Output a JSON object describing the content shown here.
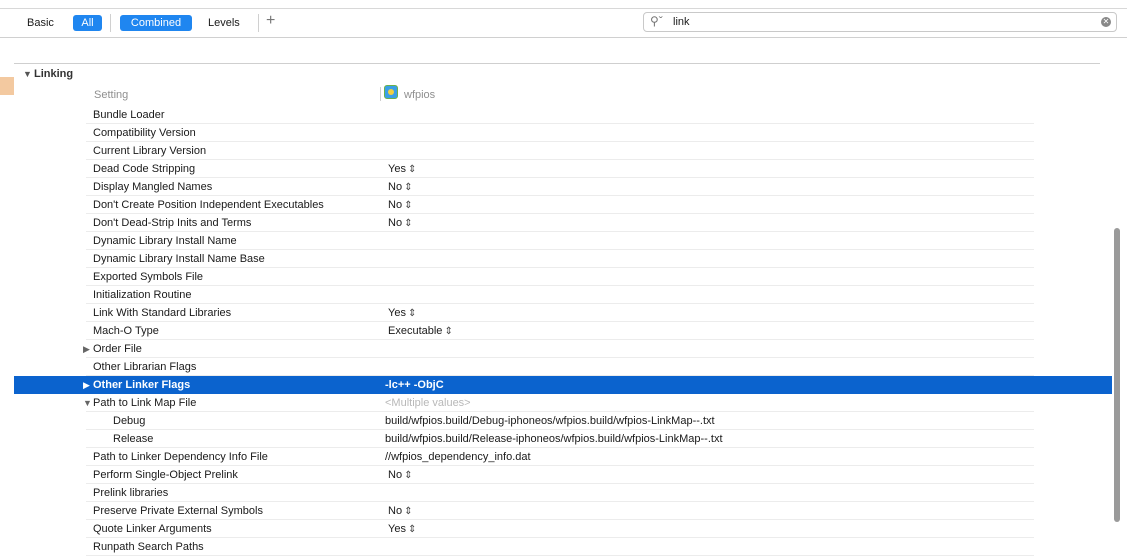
{
  "toolbar": {
    "basic": "Basic",
    "all": "All",
    "combined": "Combined",
    "levels": "Levels",
    "add": "+",
    "search_value": "link"
  },
  "section": {
    "title": "Linking"
  },
  "columns": {
    "setting": "Setting",
    "target": "wfpios"
  },
  "rows": [
    {
      "label": "Bundle Loader",
      "value": ""
    },
    {
      "label": "Compatibility Version",
      "value": ""
    },
    {
      "label": "Current Library Version",
      "value": ""
    },
    {
      "label": "Dead Code Stripping",
      "value": "Yes"
    },
    {
      "label": "Display Mangled Names",
      "value": "No"
    },
    {
      "label": "Don't Create Position Independent Executables",
      "value": "No"
    },
    {
      "label": "Don't Dead-Strip Inits and Terms",
      "value": "No"
    },
    {
      "label": "Dynamic Library Install Name",
      "value": ""
    },
    {
      "label": "Dynamic Library Install Name Base",
      "value": ""
    },
    {
      "label": "Exported Symbols File",
      "value": ""
    },
    {
      "label": "Initialization Routine",
      "value": ""
    },
    {
      "label": "Link With Standard Libraries",
      "value": "Yes"
    },
    {
      "label": "Mach-O Type",
      "value": "Executable"
    },
    {
      "label": "Order File",
      "value": ""
    },
    {
      "label": "Other Librarian Flags",
      "value": ""
    },
    {
      "label": "Other Linker Flags",
      "value": "-lc++ -ObjC"
    },
    {
      "label": "Path to Link Map File",
      "value": "<Multiple values>"
    },
    {
      "label": "Debug",
      "value": "build/wfpios.build/Debug-iphoneos/wfpios.build/wfpios-LinkMap--.txt"
    },
    {
      "label": "Release",
      "value": "build/wfpios.build/Release-iphoneos/wfpios.build/wfpios-LinkMap--.txt"
    },
    {
      "label": "Path to Linker Dependency Info File",
      "value": "//wfpios_dependency_info.dat"
    },
    {
      "label": "Perform Single-Object Prelink",
      "value": "No"
    },
    {
      "label": "Prelink libraries",
      "value": ""
    },
    {
      "label": "Preserve Private External Symbols",
      "value": "No"
    },
    {
      "label": "Quote Linker Arguments",
      "value": "Yes"
    },
    {
      "label": "Runpath Search Paths",
      "value": ""
    }
  ]
}
